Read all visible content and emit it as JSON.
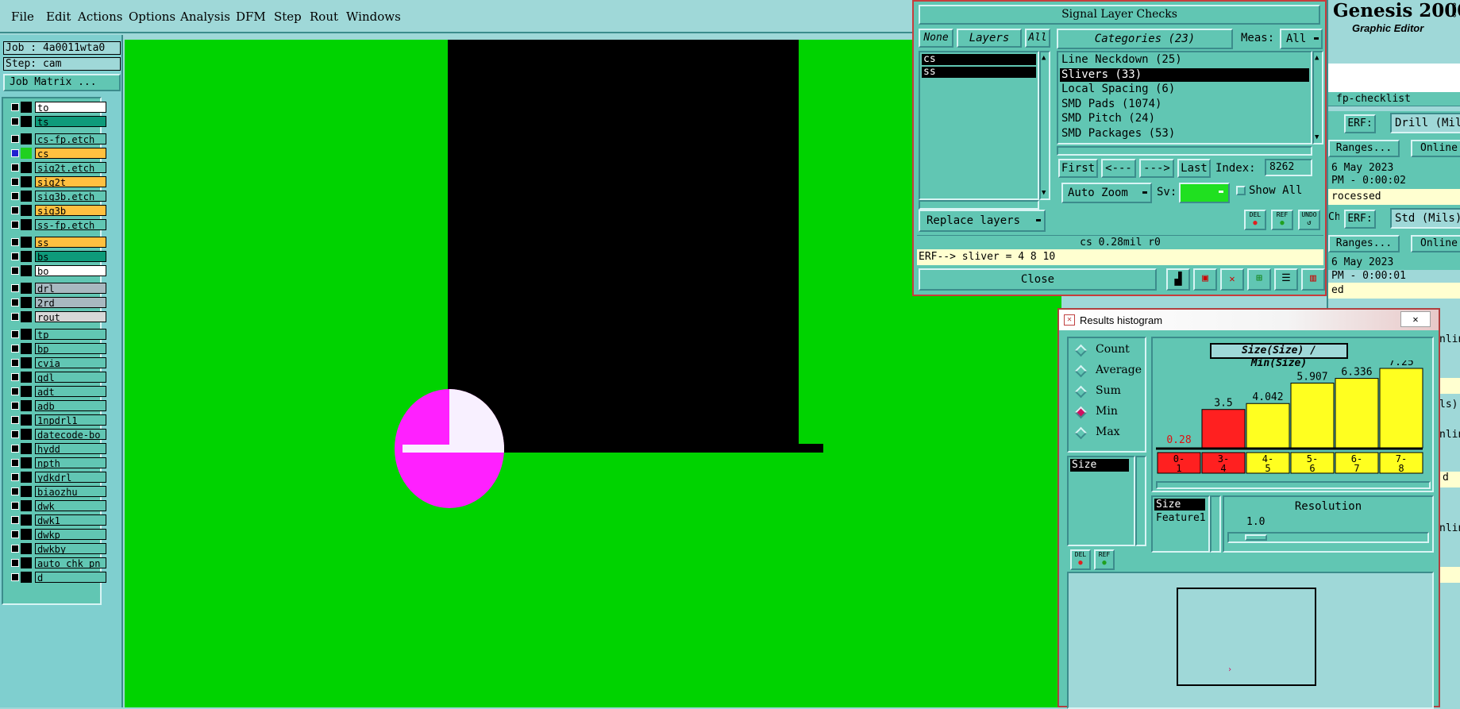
{
  "menubar": {
    "items": [
      "File",
      "Edit",
      "Actions",
      "Options",
      "Analysis",
      "DFM",
      "Step",
      "Rout",
      "Windows"
    ]
  },
  "left": {
    "job": "Job : 4a0011wta0",
    "step": "Step: cam",
    "job_matrix": "Job Matrix ...",
    "layers": [
      {
        "name": "to",
        "color": "#ffffff"
      },
      {
        "name": "ts",
        "color": "#0e9a7a"
      },
      {
        "name": "cs-fp.etch",
        "color": "#61c6b3"
      },
      {
        "name": "cs",
        "color": "#ffc040"
      },
      {
        "name": "sig2t.etch",
        "color": "#61c6b3"
      },
      {
        "name": "sig2t",
        "color": "#ffc040"
      },
      {
        "name": "sig3b.etch",
        "color": "#61c6b3"
      },
      {
        "name": "sig3b",
        "color": "#ffc040"
      },
      {
        "name": "ss-fp.etch",
        "color": "#61c6b3"
      },
      {
        "name": "ss",
        "color": "#ffc040"
      },
      {
        "name": "bs",
        "color": "#0e9a7a"
      },
      {
        "name": "bo",
        "color": "#ffffff"
      },
      {
        "name": "drl",
        "color": "#a8b8c0"
      },
      {
        "name": "2rd",
        "color": "#a8b8c0"
      },
      {
        "name": "rout",
        "color": "#d8d8d8"
      },
      {
        "name": "tp",
        "color": "#61c6b3"
      },
      {
        "name": "bp",
        "color": "#61c6b3"
      },
      {
        "name": "cvia",
        "color": "#61c6b3"
      },
      {
        "name": "gdl",
        "color": "#61c6b3"
      },
      {
        "name": "adt",
        "color": "#61c6b3"
      },
      {
        "name": "adb",
        "color": "#61c6b3"
      },
      {
        "name": "1npdrl1",
        "color": "#61c6b3"
      },
      {
        "name": "datecode-bo",
        "color": "#61c6b3"
      },
      {
        "name": "hydd",
        "color": "#61c6b3"
      },
      {
        "name": "npth",
        "color": "#61c6b3"
      },
      {
        "name": "ydkdrl",
        "color": "#61c6b3"
      },
      {
        "name": "biaozhu",
        "color": "#61c6b3"
      },
      {
        "name": "dwk",
        "color": "#61c6b3"
      },
      {
        "name": "dwk1",
        "color": "#61c6b3"
      },
      {
        "name": "dwkp",
        "color": "#61c6b3"
      },
      {
        "name": "dwkby",
        "color": "#61c6b3"
      },
      {
        "name": "auto_chk_pn",
        "color": "#61c6b3"
      },
      {
        "name": "d",
        "color": "#61c6b3"
      }
    ]
  },
  "slc": {
    "title": "Signal Layer Checks",
    "none": "None",
    "layers": "Layers",
    "all": "All",
    "categories": "Categories (23)",
    "meas_label": "Meas:",
    "meas_value": "All",
    "layer_list": [
      "cs",
      "ss"
    ],
    "category_list": [
      "Line Neckdown (25)",
      "Slivers (33)",
      "Local Spacing (6)",
      "SMD Pads (1074)",
      "SMD Pitch (24)",
      "SMD Packages (53)"
    ],
    "first": "First",
    "prev": "<---",
    "next": "--->",
    "last": "Last",
    "index_label": "Index:",
    "index_value": "8262",
    "auto_zoom": "Auto Zoom",
    "sv_label": "Sv:",
    "show_all": "Show All",
    "replace_layers": "Replace layers",
    "del": "DEL",
    "ref": "REF",
    "undo": "UNDO",
    "status": "cs 0.28mil  r0",
    "erf": "ERF--> sliver = 4 8 10",
    "close": "Close"
  },
  "genesis": {
    "title": "Genesis 2000",
    "subtitle": "Graphic Editor",
    "checklist": "fp-checklist",
    "erf_label": "ERF:",
    "erf1_value": "Drill (Mil",
    "ranges": "Ranges...",
    "online": "Online",
    "date1": "6 May 2023",
    "time1": "PM - 0:00:02",
    "status1": "rocessed",
    "che": "Che",
    "erf2_value": "Std (Mils)",
    "date2": "6 May 2023",
    "time2": "PM - 0:00:01",
    "status2": "ed",
    "frag_online1": "nline",
    "frag_ls": "ls)",
    "frag_online2": "nline",
    "frag_d": "d",
    "frag_online3": "nline"
  },
  "histogram": {
    "window_title": "Results histogram",
    "radios": [
      "Count",
      "Average",
      "Sum",
      "Min",
      "Max"
    ],
    "selected_radio": "Min",
    "attr_list": [
      "Size"
    ],
    "chart_title": "Size(Size) / Min(Size)",
    "attr_list2": [
      "Size",
      "Feature1"
    ],
    "resolution_label": "Resolution",
    "resolution_value": "1.0",
    "del": "DEL",
    "ref": "REF"
  },
  "chart_data": {
    "type": "bar",
    "title": "Size(Size) / Min(Size)",
    "categories": [
      "0-1",
      "3-4",
      "4-5",
      "5-6",
      "6-7",
      "7-8"
    ],
    "values": [
      0.28,
      3.5,
      4.042,
      5.907,
      6.336,
      7.25
    ],
    "value_labels": [
      "0.28",
      "3.5",
      "4.042",
      "5.907",
      "6.336",
      "7.25"
    ],
    "colors": [
      "#ff2020",
      "#ff2020",
      "#ffff20",
      "#ffff20",
      "#ffff20",
      "#ffff20"
    ],
    "ylim": [
      0,
      7.25
    ]
  },
  "colors": {
    "canvas_bg": "#00d300",
    "magenta": "#ff20ff",
    "red": "#ff2020",
    "yellow": "#ffff20",
    "panel": "#61c6b3"
  }
}
